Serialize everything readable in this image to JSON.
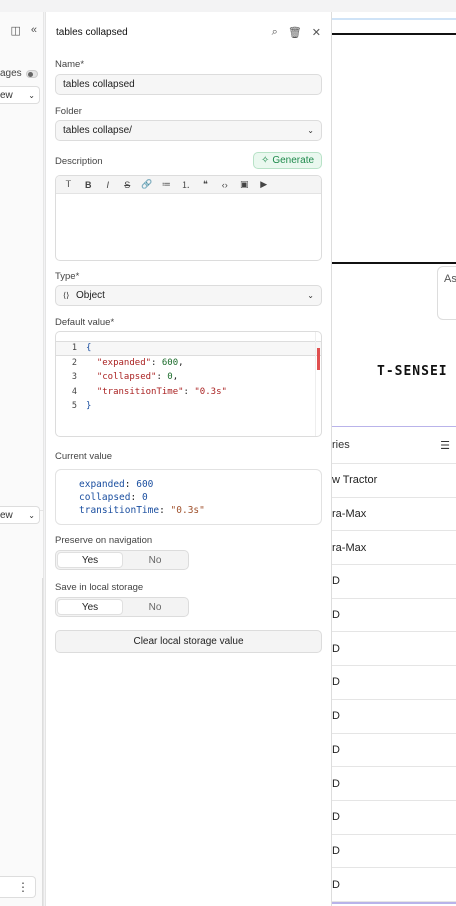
{
  "left_strip": {
    "pages_label": "ages",
    "view_chip_top": "ew",
    "view_chip_bottom": "ew",
    "more_icon": "⋮"
  },
  "panel": {
    "title": "tables collapsed",
    "name": {
      "label": "Name",
      "value": "tables collapsed"
    },
    "folder": {
      "label": "Folder",
      "value": "tables collapse/"
    },
    "description": {
      "label": "Description",
      "generate_label": "Generate"
    },
    "type": {
      "label": "Type",
      "value": "Object",
      "glyph": "⟨⟩"
    },
    "default_value": {
      "label": "Default value",
      "lines": [
        {
          "num": "1",
          "parts": [
            [
              "{",
              "p"
            ]
          ]
        },
        {
          "num": "2",
          "parts": [
            [
              "  ",
              ""
            ],
            [
              "\"expanded\"",
              "k"
            ],
            [
              ": ",
              ""
            ],
            [
              "600",
              "n"
            ],
            [
              ",",
              ""
            ]
          ]
        },
        {
          "num": "3",
          "parts": [
            [
              "  ",
              ""
            ],
            [
              "\"collapsed\"",
              "k"
            ],
            [
              ": ",
              ""
            ],
            [
              "0",
              "n"
            ],
            [
              ",",
              ""
            ]
          ]
        },
        {
          "num": "4",
          "parts": [
            [
              "  ",
              ""
            ],
            [
              "\"transitionTime\"",
              "k"
            ],
            [
              ": ",
              ""
            ],
            [
              "\"0.3s\"",
              "s"
            ]
          ]
        },
        {
          "num": "5",
          "parts": [
            [
              "}",
              "p"
            ]
          ]
        }
      ]
    },
    "current_value": {
      "label": "Current value",
      "entries": [
        {
          "key": "expanded",
          "value": "600"
        },
        {
          "key": "collapsed",
          "value": "0"
        },
        {
          "key": "transitionTime",
          "value": "\"0.3s\""
        }
      ]
    },
    "preserve": {
      "label": "Preserve on navigation",
      "yes": "Yes",
      "no": "No",
      "selected": "Yes"
    },
    "local_storage": {
      "label": "Save in local storage",
      "yes": "Yes",
      "no": "No",
      "selected": "Yes"
    },
    "clear_button": "Clear local storage value"
  },
  "right_preview": {
    "input_placeholder": "As",
    "brand": "T-SENSEI IS",
    "column_header": "ries",
    "rows": [
      "w Tractor",
      "ra-Max",
      "ra-Max",
      "D",
      "D",
      "D",
      "D",
      "D",
      "D",
      "D",
      "D",
      "D",
      "D"
    ]
  },
  "colors": {
    "generate_bg": "#eaf8ef",
    "generate_text": "#1f8a4c",
    "code_key": "#aa2222",
    "code_number": "#1a6b2a",
    "accent_line": "#b9b3ea"
  }
}
